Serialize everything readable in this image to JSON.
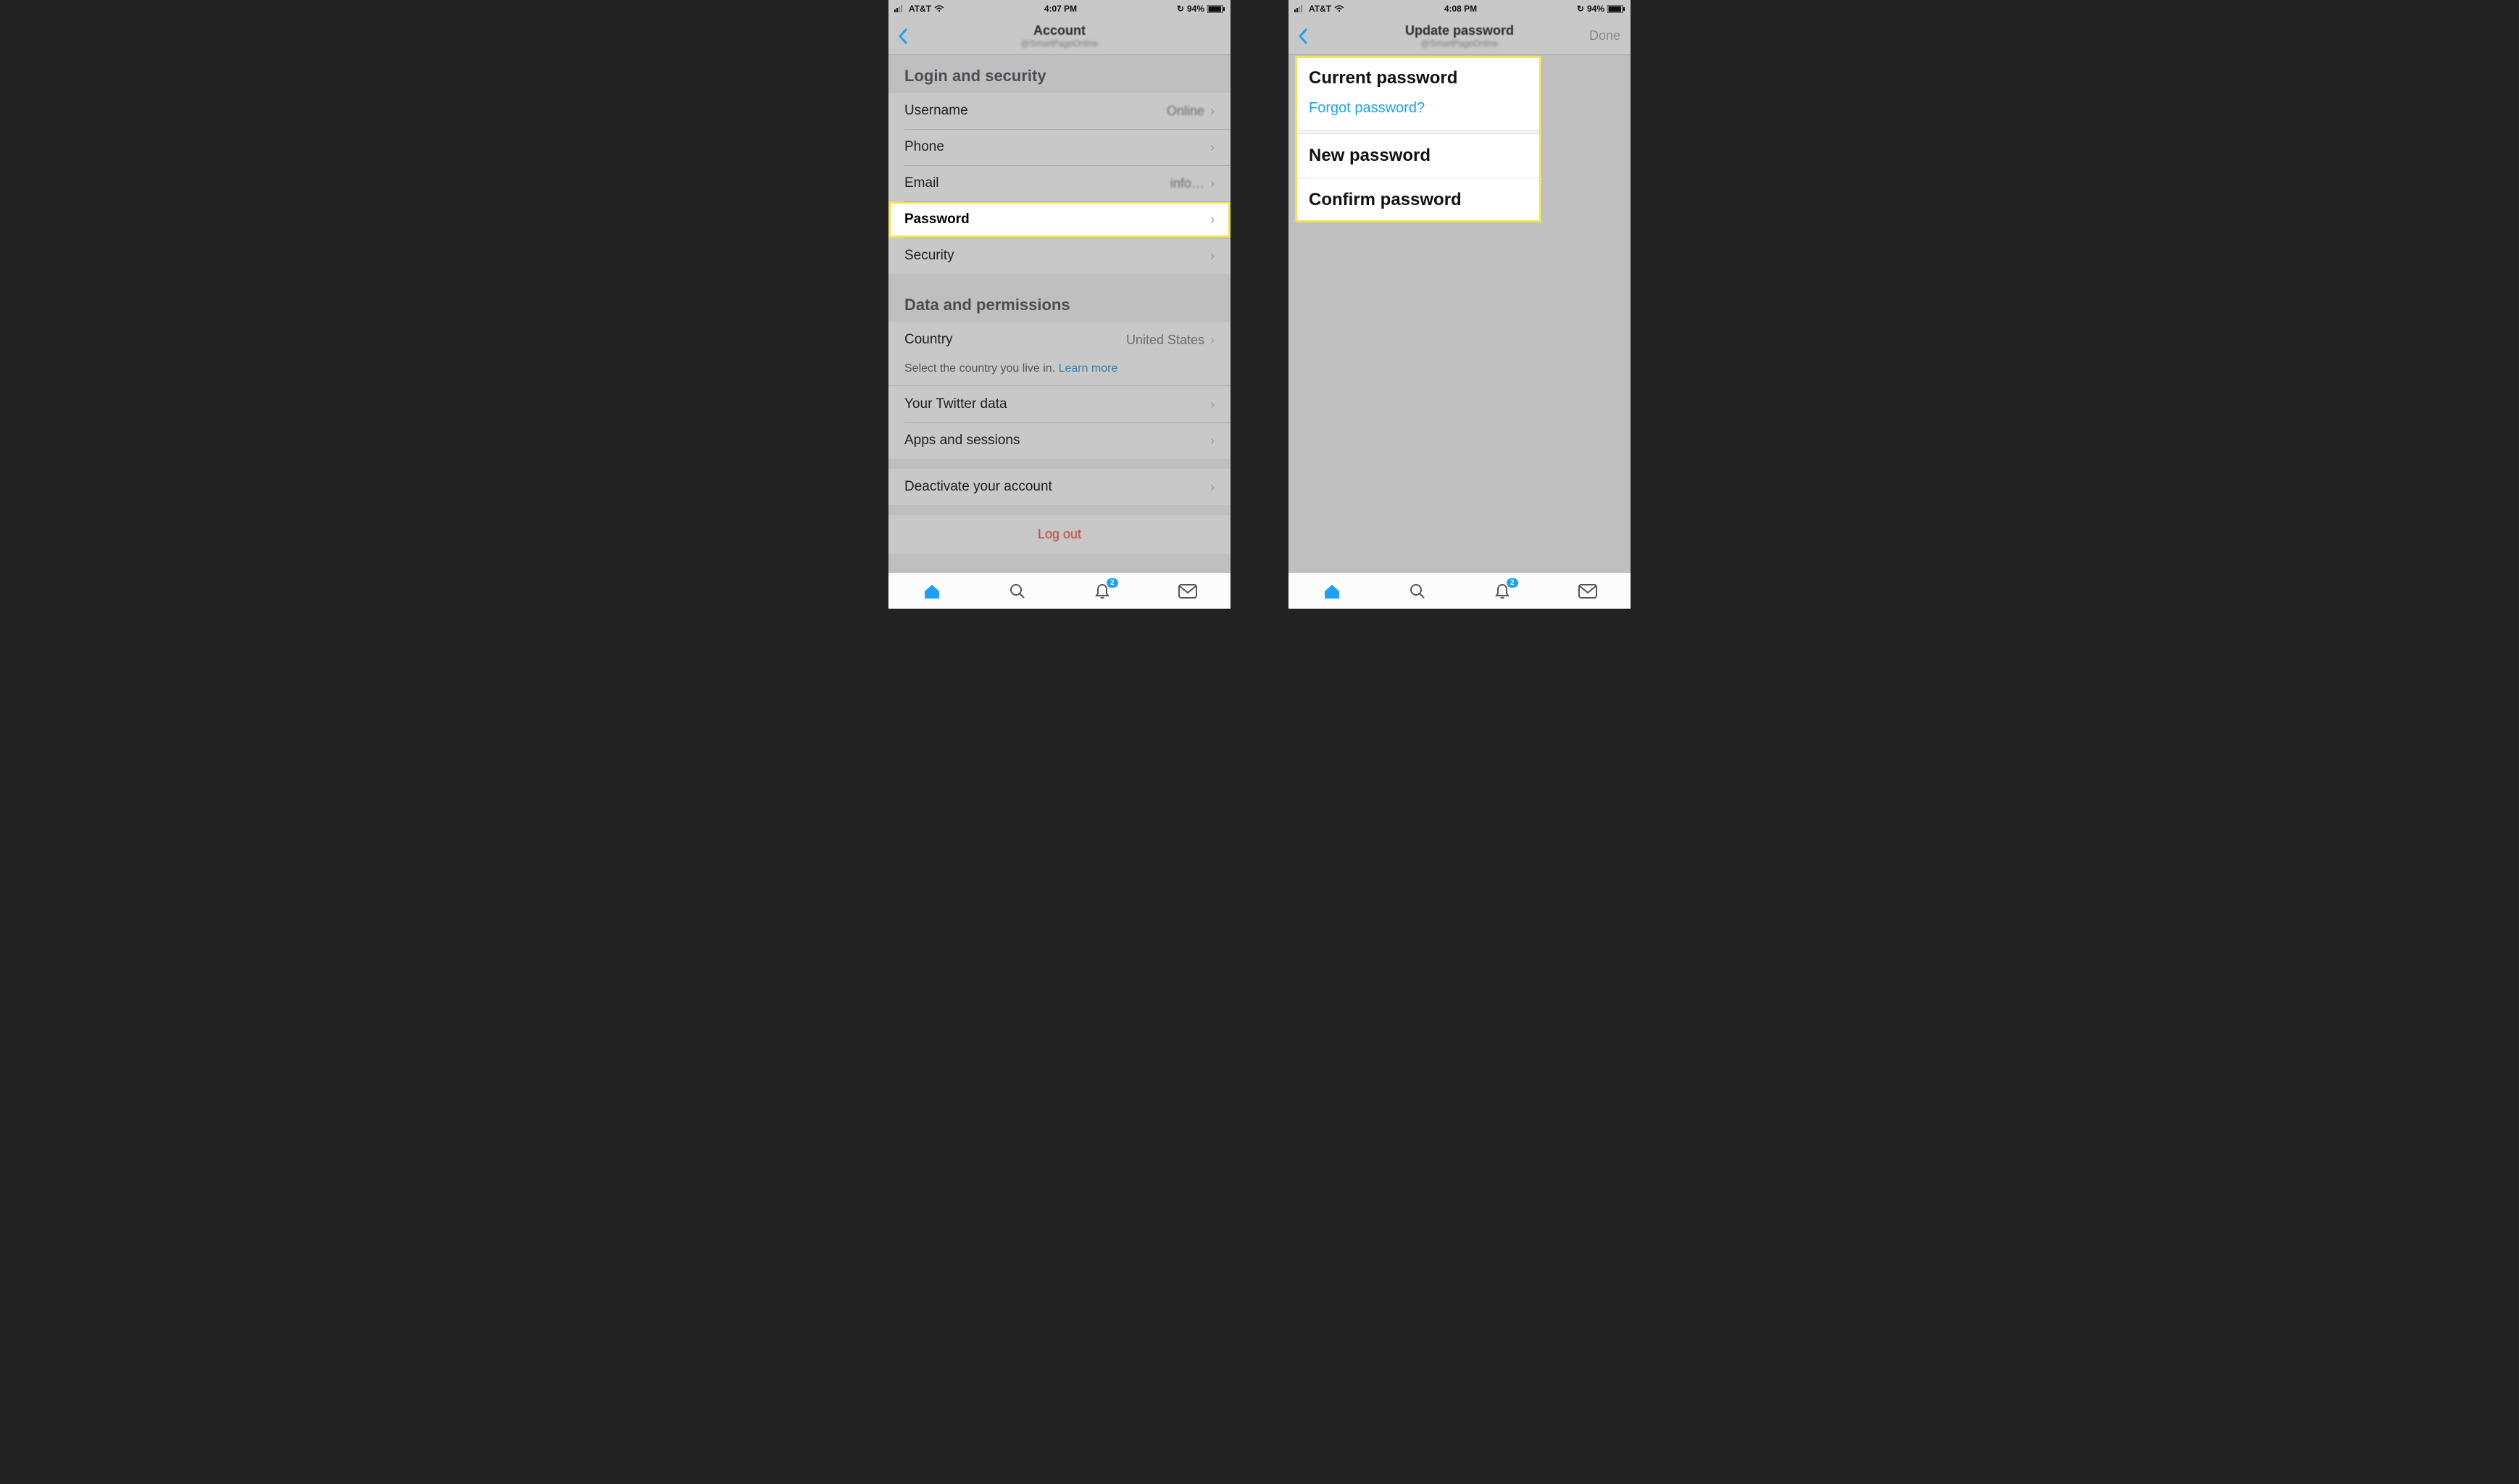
{
  "phone1": {
    "status": {
      "carrier": "AT&T",
      "time": "4:07 PM",
      "battery": "94%"
    },
    "nav": {
      "title": "Account",
      "subtitle": "@SmartPageOnline"
    },
    "section1": {
      "title": "Login and security",
      "rows": {
        "username": {
          "label": "Username",
          "value": "Online"
        },
        "phone": {
          "label": "Phone",
          "value": ""
        },
        "email": {
          "label": "Email",
          "value": "info…"
        },
        "password": {
          "label": "Password",
          "value": ""
        },
        "security": {
          "label": "Security",
          "value": ""
        }
      }
    },
    "section2": {
      "title": "Data and permissions",
      "rows": {
        "country": {
          "label": "Country",
          "value": "United States"
        },
        "countryNote": "Select the country you live in.",
        "countryLearn": "Learn more",
        "twitterdata": {
          "label": "Your Twitter data"
        },
        "apps": {
          "label": "Apps and sessions"
        },
        "deactivate": {
          "label": "Deactivate your account"
        }
      }
    },
    "logout": "Log out",
    "badge": "2"
  },
  "phone2": {
    "status": {
      "carrier": "AT&T",
      "time": "4:08 PM",
      "battery": "94%"
    },
    "nav": {
      "title": "Update password",
      "subtitle": "@SmartPageOnline",
      "done": "Done"
    },
    "card": {
      "current": "Current password",
      "forgot": "Forgot password?",
      "new": "New password",
      "confirm": "Confirm password"
    },
    "badge": "2"
  }
}
